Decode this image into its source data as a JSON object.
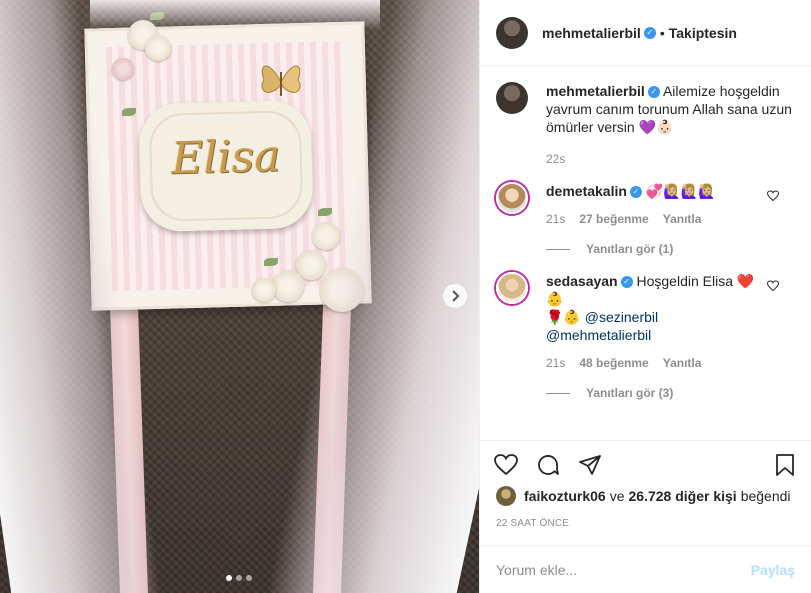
{
  "media": {
    "plaque_text": "Elisa",
    "carousel_dots": 3,
    "carousel_active": 0,
    "next_icon": "chevron-right-icon"
  },
  "header": {
    "username": "mehmetalierbil",
    "separator": "•",
    "follow_label": "Takiptesin"
  },
  "caption": {
    "username": "mehmetalierbil",
    "text": "Ailemize hoşgeldin yavrum canım torunum Allah sana uzun ömürler versin 💜👶🏻",
    "time": "22s"
  },
  "comments": [
    {
      "username": "demetakalin",
      "text": "💞🙋🏼‍♀️🙋🏼‍♀️🙋🏼‍♀️",
      "time": "21s",
      "likes": "27 beğenme",
      "reply_label": "Yanıtla",
      "view_replies": "Yanıtları gör (1)"
    },
    {
      "username": "sedasayan",
      "text_prefix": "Hoşgeldin Elisa ❤️👶",
      "text_line2_prefix": "🌹👶 ",
      "mention1": "@sezinerbil",
      "mention2": "@mehmetalierbil",
      "time": "21s",
      "likes": "48 beğenme",
      "reply_label": "Yanıtla",
      "view_replies": "Yanıtları gör (3)"
    }
  ],
  "actions": {
    "like_icon": "heart-icon",
    "comment_icon": "comment-icon",
    "share_icon": "share-icon",
    "save_icon": "bookmark-icon"
  },
  "likes": {
    "user": "faikozturk06",
    "connector": "ve",
    "others": "26.728 diğer kişi",
    "suffix": "beğendi"
  },
  "timestamp": "22 SAAT ÖNCE",
  "add_comment": {
    "placeholder": "Yorum ekle...",
    "post_label": "Paylaş"
  },
  "colors": {
    "link_dark": "#003569",
    "verified": "#3897f0",
    "story_ring": "#c32aa3",
    "post_disabled": "#b2dffc",
    "muted": "#8e8e8e"
  }
}
